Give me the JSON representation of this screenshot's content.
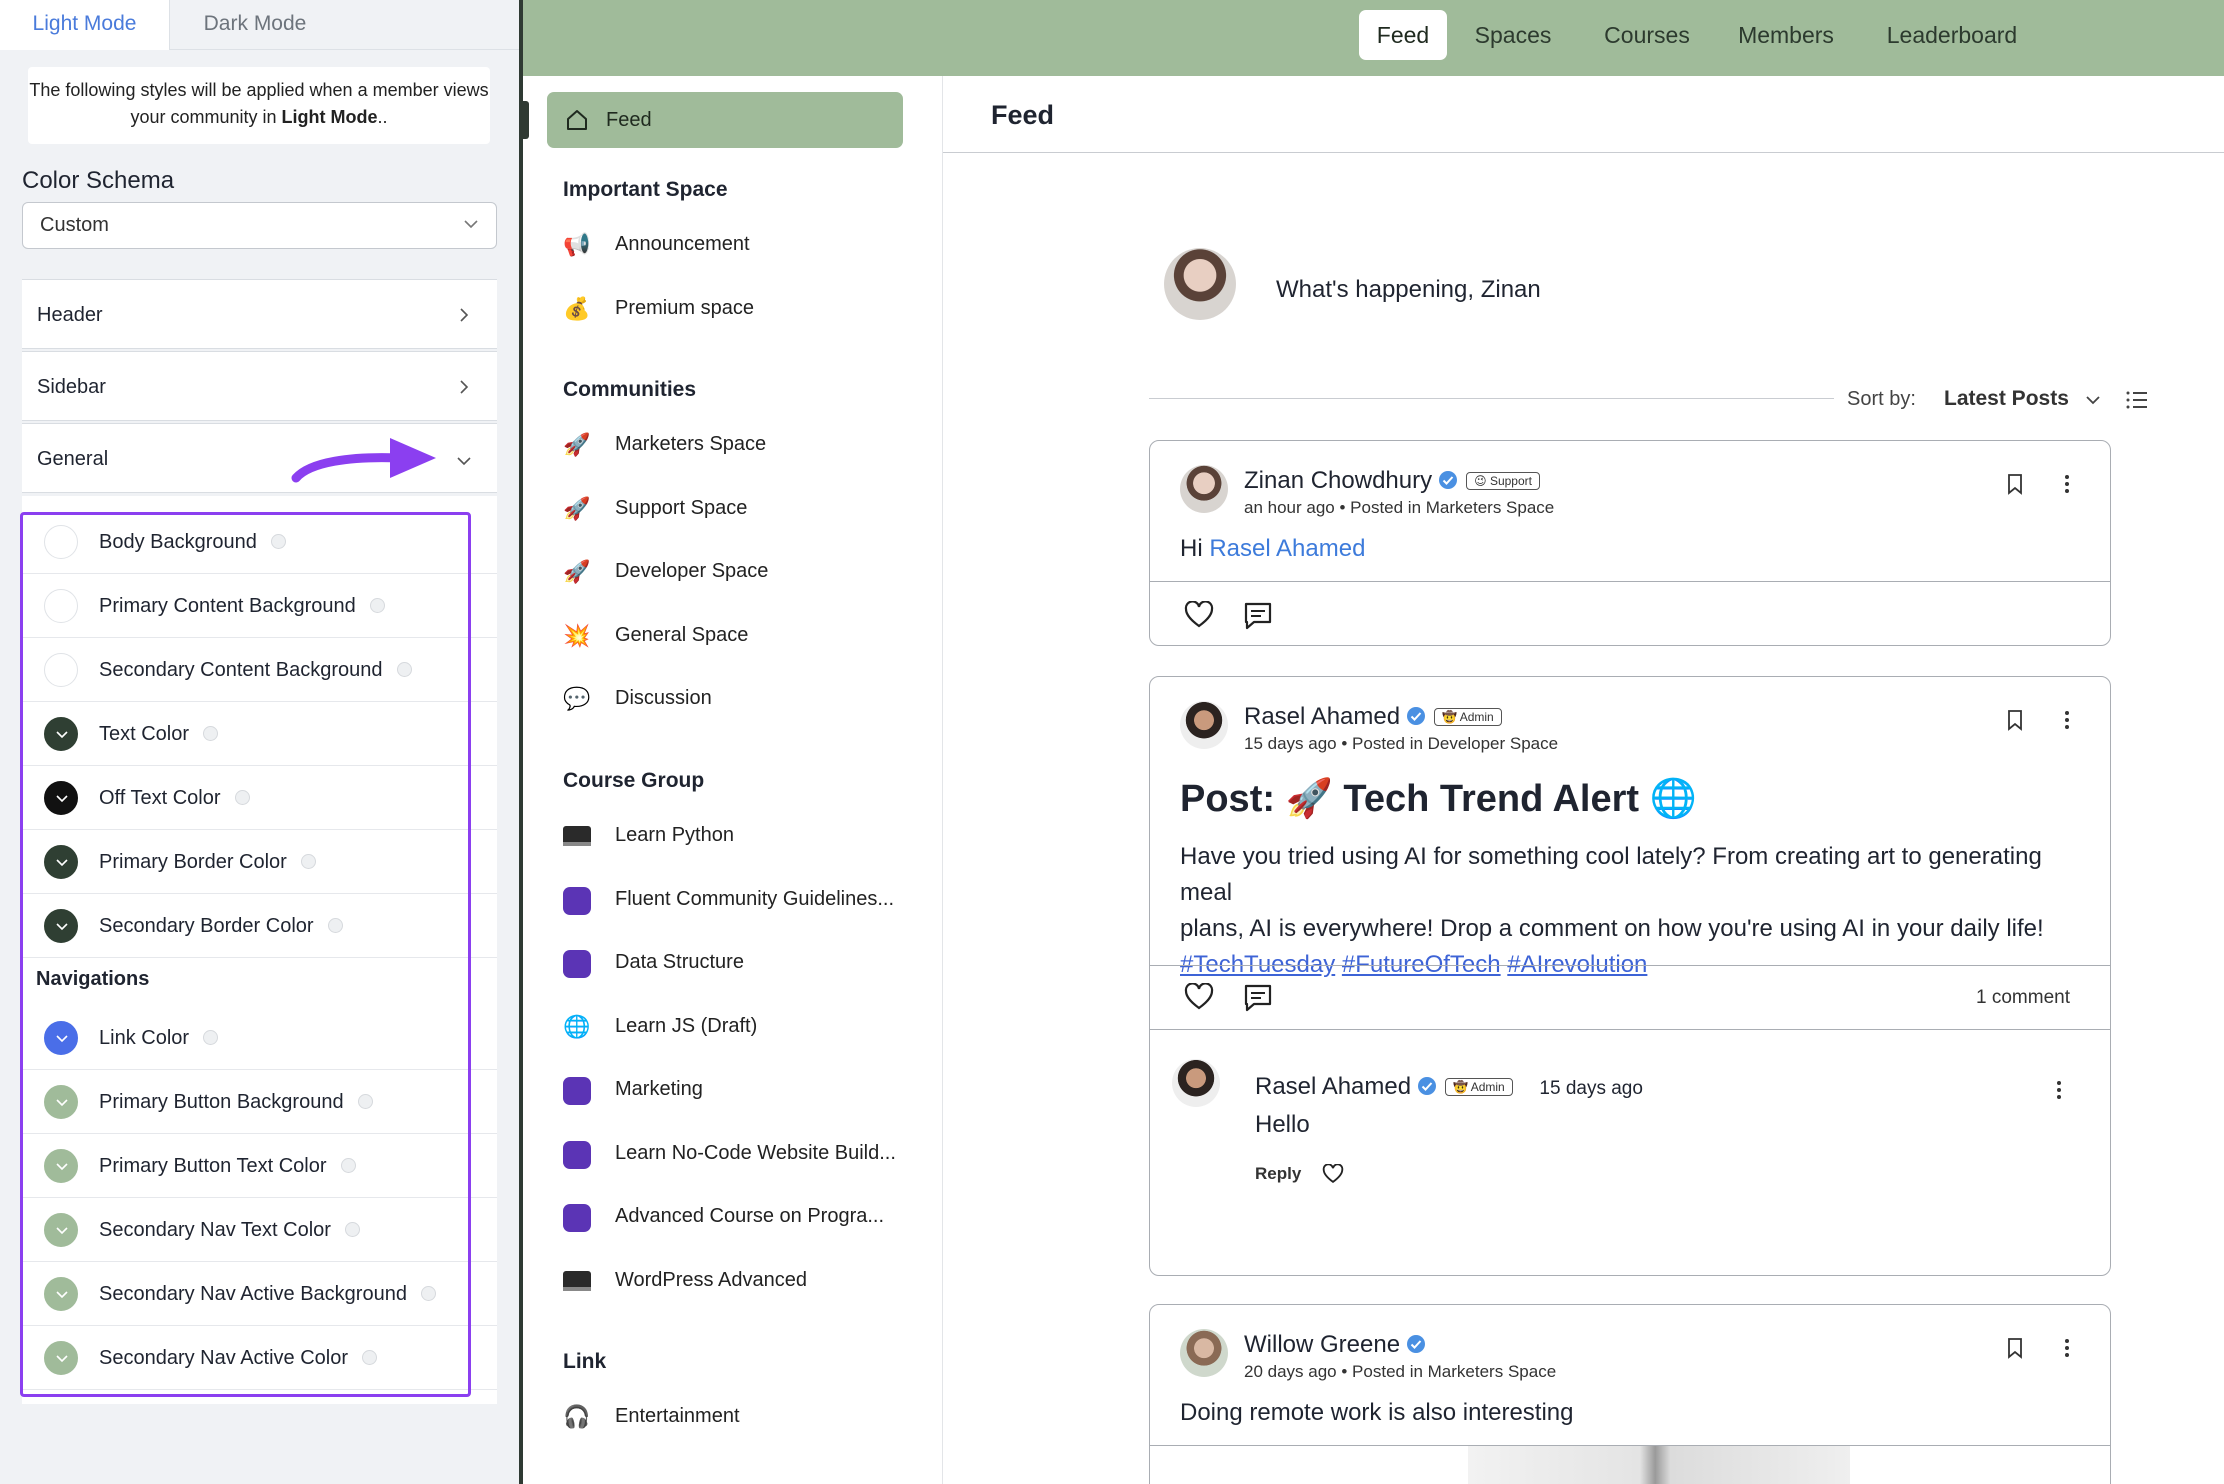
{
  "settings": {
    "tabs": {
      "light": "Light Mode",
      "dark": "Dark Mode"
    },
    "note_pre": "The following styles will be applied when a member views your community in ",
    "note_strong": "Light Mode",
    "note_post": "..",
    "color_schema_label": "Color Schema",
    "color_schema_value": "Custom",
    "sections": {
      "header": "Header",
      "sidebar": "Sidebar",
      "general": "General"
    },
    "general_colors": [
      {
        "label": "Body Background",
        "color": "#ffffff"
      },
      {
        "label": "Primary Content Background",
        "color": "#ffffff"
      },
      {
        "label": "Secondary Content Background",
        "color": "#ffffff"
      },
      {
        "label": "Text Color",
        "color": "#2f3f33"
      },
      {
        "label": "Off Text Color",
        "color": "#111111"
      },
      {
        "label": "Primary Border Color",
        "color": "#2f3f33"
      },
      {
        "label": "Secondary Border Color",
        "color": "#2f3f33"
      }
    ],
    "navigations_label": "Navigations",
    "nav_colors": [
      {
        "label": "Link Color",
        "color": "#4a6ee8"
      },
      {
        "label": "Primary Button Background",
        "color": "#a0bb9a"
      },
      {
        "label": "Primary Button Text Color",
        "color": "#a0bb9a"
      },
      {
        "label": "Secondary Nav Text Color",
        "color": "#a0bb9a"
      },
      {
        "label": "Secondary Nav Active Background",
        "color": "#a0bb9a"
      },
      {
        "label": "Secondary Nav Active Color",
        "color": "#a0bb9a"
      }
    ]
  },
  "topnav": [
    "Feed",
    "Spaces",
    "Courses",
    "Members",
    "Leaderboard"
  ],
  "sidebar": {
    "active": "Feed",
    "groups": [
      {
        "title": "Important Space",
        "items": [
          {
            "label": "Announcement",
            "icon": "📢"
          },
          {
            "label": "Premium space",
            "icon": "💰"
          }
        ]
      },
      {
        "title": "Communities",
        "items": [
          {
            "label": "Marketers Space",
            "icon": "🚀"
          },
          {
            "label": "Support Space",
            "icon": "🚀"
          },
          {
            "label": "Developer Space",
            "icon": "🚀"
          },
          {
            "label": "General Space",
            "icon": "💥"
          },
          {
            "label": "Discussion",
            "icon": "💬"
          }
        ]
      },
      {
        "title": "Course Group",
        "items": [
          {
            "label": "Learn Python",
            "icon": "laptop"
          },
          {
            "label": "Fluent Community Guidelines...",
            "icon": "square"
          },
          {
            "label": "Data Structure",
            "icon": "square"
          },
          {
            "label": "Learn JS (Draft)",
            "icon": "🌐"
          },
          {
            "label": "Marketing",
            "icon": "square"
          },
          {
            "label": "Learn No-Code Website Build...",
            "icon": "square"
          },
          {
            "label": "Advanced Course on Progra...",
            "icon": "square"
          },
          {
            "label": "WordPress Advanced",
            "icon": "laptop"
          }
        ]
      },
      {
        "title": "Link",
        "items": [
          {
            "label": "Entertainment",
            "icon": "🎧"
          }
        ]
      }
    ]
  },
  "feed": {
    "title": "Feed",
    "composer_placeholder": "What's happening, Zinan",
    "sort_label": "Sort by:",
    "sort_value": "Latest Posts",
    "posts": [
      {
        "author": "Zinan Chowdhury",
        "badge": "😉 Support",
        "time": "an hour ago",
        "space": "Posted in Marketers Space",
        "body_pre": "Hi ",
        "mention": "Rasel Ahamed"
      },
      {
        "author": "Rasel Ahamed",
        "badge": "🤠 Admin",
        "time": "15 days ago",
        "space": "Posted in Developer Space",
        "title": "Post: 🚀 Tech Trend Alert 🌐",
        "body_line1": "Have you tried using AI for something cool lately? From creating art to generating meal",
        "body_line2": "plans, AI is everywhere! Drop a comment on how you're using AI in your daily life!",
        "hashtags": [
          "#TechTuesday",
          "#FutureOfTech",
          "#AIrevolution"
        ],
        "comments_count": "1 comment",
        "comment": {
          "author": "Rasel Ahamed",
          "badge": "🤠 Admin",
          "time": "15 days ago",
          "text": "Hello",
          "reply": "Reply"
        }
      },
      {
        "author": "Willow Greene",
        "time": "20 days ago",
        "space": "Posted in Marketers Space",
        "body": "Doing remote work is also interesting"
      }
    ]
  },
  "colors": {
    "accent_green": "#a0bb9a",
    "dark_border": "#2f3a33",
    "highlight_purple": "#8b3ff0",
    "link_blue": "#3d7bdb"
  }
}
